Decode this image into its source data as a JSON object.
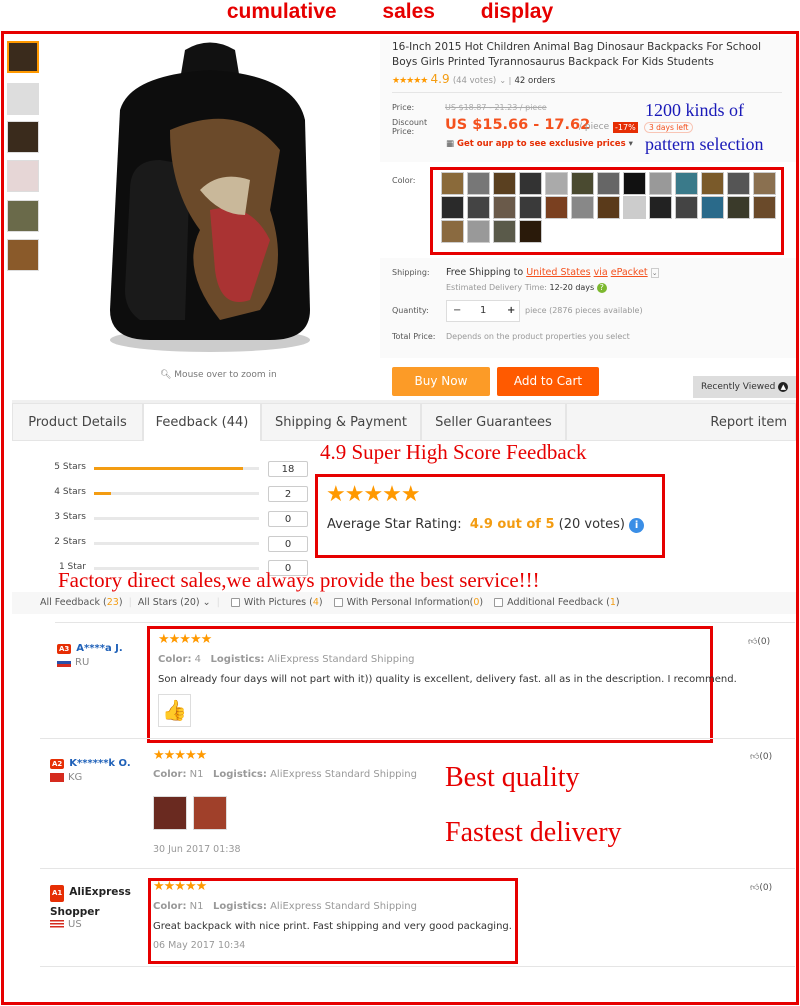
{
  "banner": {
    "title": "cumulative sales display"
  },
  "product": {
    "title": "16-Inch 2015 Hot Children Animal Bag Dinosaur Backpacks For School Boys Girls Printed Tyrannosaurus Backpack For Kids Students",
    "stars": "★★★★★",
    "rating": "4.9",
    "votes": "(44 votes)",
    "orders": "42 orders",
    "price_label": "Price:",
    "orig_price": "US $18.87 - 21.23 / piece",
    "discount_label": "Discount Price:",
    "discount_price": "US $15.66 - 17.62",
    "per_piece": "/ piece",
    "discount_pct": "-17%",
    "days_left": "3 days left",
    "app_promo": "Get our app to see exclusive prices",
    "color_label": "Color:",
    "swatch_colors": [
      "#8a6a3a",
      "#777",
      "#5a4020",
      "#333",
      "#aaa",
      "#4a4a30",
      "#666",
      "#111",
      "#999",
      "#3a7a8a",
      "#7a5a2a",
      "#555",
      "#8a7050",
      "#2a2a2a",
      "#444",
      "#6a5a4a",
      "#3a3a3a",
      "#7a4020",
      "#888",
      "#5a3a1a",
      "#ccc",
      "#222",
      "#444",
      "#2a6a8a",
      "#3a3a2a",
      "#6a4a2a",
      "#8a6a40",
      "#999",
      "#5a5a4a",
      "#2a1a0a"
    ],
    "shipping_label": "Shipping:",
    "shipping_free": "Free Shipping to",
    "shipping_country": "United States",
    "shipping_via": "via",
    "shipping_method": "ePacket",
    "delivery_label": "Estimated Delivery Time:",
    "delivery_days": "12-20 days",
    "quantity_label": "Quantity:",
    "quantity": "1",
    "minus": "−",
    "plus": "+",
    "available": "piece (2876 pieces available)",
    "total_label": "Total Price:",
    "total_value": "Depends on the product properties you select",
    "buy_now": "Buy Now",
    "add_to_cart": "Add to Cart",
    "recently_viewed": "Recently Viewed",
    "zoom_hint": "Mouse over to zoom in"
  },
  "promo": {
    "patterns_1": "1200 kinds of",
    "patterns_2": "pattern selection",
    "high_score": "4.9 Super High Score Feedback",
    "factory": "Factory direct sales,we always provide the best service!!!",
    "quality": "Best quality",
    "delivery": "Fastest delivery"
  },
  "tabs": [
    {
      "label": "Product Details"
    },
    {
      "label": "Feedback (44)"
    },
    {
      "label": "Shipping & Payment"
    },
    {
      "label": "Seller Guarantees"
    },
    {
      "label": "Report item"
    }
  ],
  "ratings": [
    {
      "label": "5 Stars",
      "count": "18",
      "fraction": 0.9
    },
    {
      "label": "4 Stars",
      "count": "2",
      "fraction": 0.1
    },
    {
      "label": "3 Stars",
      "count": "0",
      "fraction": 0
    },
    {
      "label": "2 Stars",
      "count": "0",
      "fraction": 0
    },
    {
      "label": "1 Star",
      "count": "0",
      "fraction": 0
    }
  ],
  "summary": {
    "stars": "★★★★★",
    "label": "Average Star Rating:",
    "value": "4.9 out of 5",
    "votes": "(20 votes)"
  },
  "filters": {
    "all": "All Feedback (",
    "all_n": "23",
    "all_stars": "All Stars (20)",
    "pictures": "With Pictures (",
    "pictures_n": "4",
    "personal": "With Personal Information(",
    "personal_n": "0",
    "additional": "Additional Feedback (",
    "additional_n": "1",
    "close": ")"
  },
  "reviews": [
    {
      "badge": "A3",
      "name": "A****a J.",
      "country": "RU",
      "stars": "★★★★★",
      "color_label": "Color:",
      "color": "4",
      "logistics_label": "Logistics:",
      "logistics": "AliExpress Standard Shipping",
      "text": "Son already four days will not part with it)) quality is excellent, delivery fast. all as in the description. I recommend.",
      "likes": "(0)"
    },
    {
      "badge": "A2",
      "name": "K******k O.",
      "country": "KG",
      "stars": "★★★★★",
      "color_label": "Color:",
      "color": "N1",
      "logistics_label": "Logistics:",
      "logistics": "AliExpress Standard Shipping",
      "date": "30 Jun 2017 01:38",
      "likes": "(0)"
    },
    {
      "badge": "A1",
      "name": "AliExpress Shopper",
      "country": "US",
      "stars": "★★★★★",
      "color_label": "Color:",
      "color": "N1",
      "logistics_label": "Logistics:",
      "logistics": "AliExpress Standard Shipping",
      "text": "Great backpack with nice print. Fast shipping and very good packaging.",
      "date": "06 May 2017 10:34",
      "likes": "(0)"
    }
  ]
}
